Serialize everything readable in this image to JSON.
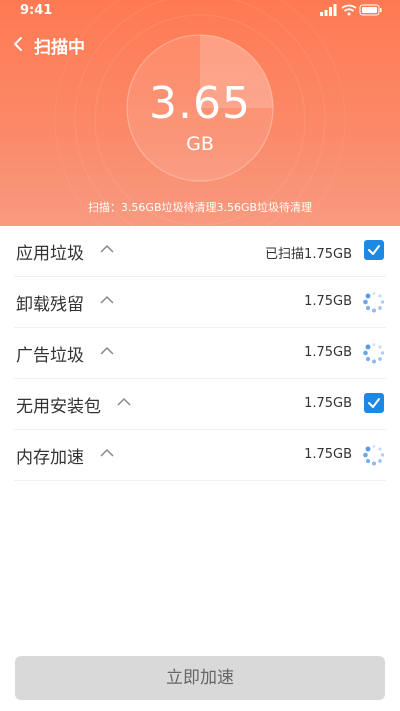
{
  "status_bar": {
    "time": "9:41"
  },
  "header": {
    "title": "扫描中",
    "size_value": "3.65",
    "size_unit": "GB",
    "scan_summary": "扫描：3.56GB垃圾待清理3.56GB垃圾待清理",
    "gauge_progress": 0.25,
    "accent_color": "#ff7a52"
  },
  "items": [
    {
      "label": "应用垃圾",
      "value": "已扫描1.75GB",
      "state": "checked"
    },
    {
      "label": "卸载残留",
      "value": "1.75GB",
      "state": "loading"
    },
    {
      "label": "广告垃圾",
      "value": "1.75GB",
      "state": "loading"
    },
    {
      "label": "无用安装包",
      "value": "1.75GB",
      "state": "checked"
    },
    {
      "label": "内存加速",
      "value": "1.75GB",
      "state": "loading"
    }
  ],
  "cta": {
    "label": "立即加速"
  },
  "colors": {
    "checkbox": "#1e88e5",
    "spinner": "#4a90e2",
    "cta_bg": "#d9d9d9"
  }
}
